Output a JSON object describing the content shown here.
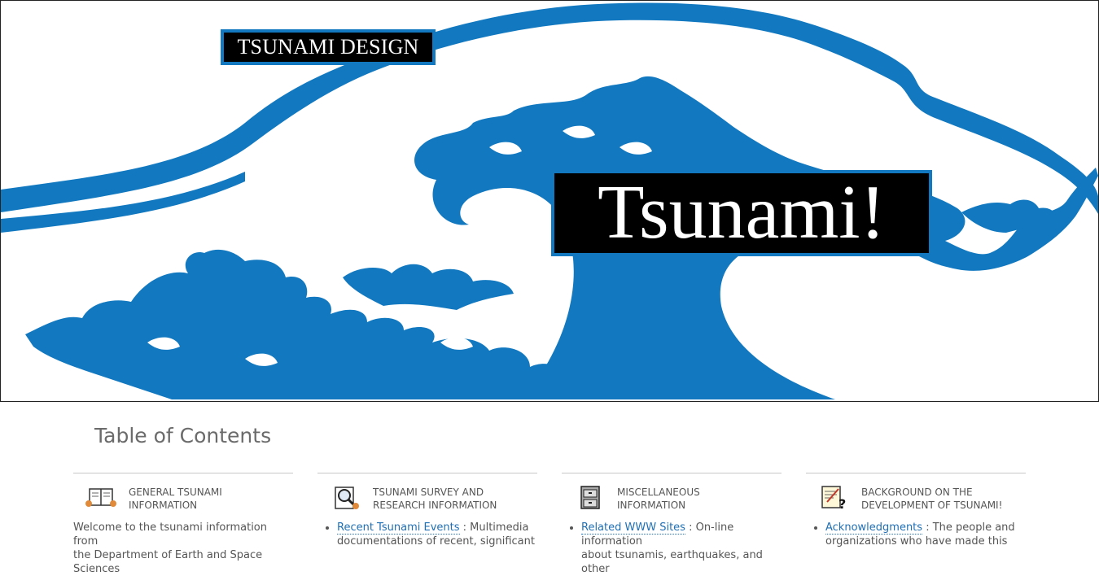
{
  "banner": {
    "small_title": "TSUNAMI DESIGN",
    "big_title": "Tsunami!",
    "wave_color": "#1279c0"
  },
  "toc": {
    "heading": "Table of Contents",
    "columns": [
      {
        "icon": "book-icon",
        "title_line1": "GENERAL TSUNAMI",
        "title_line2": "INFORMATION",
        "text": "Welcome to the tsunami information from",
        "text2": "the Department of Earth and Space Sciences"
      },
      {
        "icon": "magnifier-icon",
        "title_line1": "TSUNAMI SURVEY AND",
        "title_line2": "RESEARCH INFORMATION",
        "link": "Recent Tsunami Events",
        "text": " : Multimedia",
        "text2": "documentations of recent, significant"
      },
      {
        "icon": "file-cabinet-icon",
        "title_line1": "MISCELLANEOUS",
        "title_line2": "INFORMATION",
        "link": "Related WWW Sites",
        "text": " : On-line information",
        "text2": "about tsunamis, earthquakes, and other"
      },
      {
        "icon": "notes-question-icon",
        "title_line1": "BACKGROUND ON THE",
        "title_line2": "DEVELOPMENT OF TSUNAMI!",
        "link": "Acknowledgments",
        "text": " : The people and",
        "text2": "organizations who have made this"
      }
    ]
  }
}
